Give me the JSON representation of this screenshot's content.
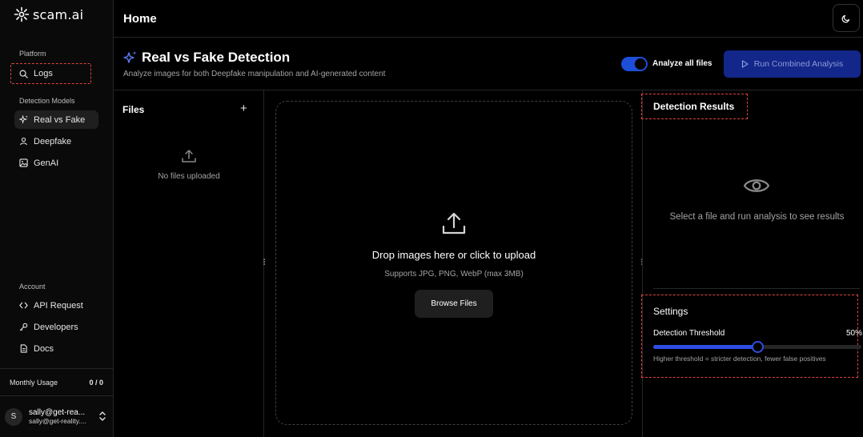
{
  "sidebar": {
    "logo": "scam.ai",
    "platform_label": "Platform",
    "logs_label": "Logs",
    "detection_models_label": "Detection Models",
    "models": [
      {
        "label": "Real vs Fake",
        "icon": "sparkles-icon",
        "active": true
      },
      {
        "label": "Deepfake",
        "icon": "user-icon",
        "active": false
      },
      {
        "label": "GenAI",
        "icon": "image-icon",
        "active": false
      }
    ],
    "account_label": "Account",
    "account_items": [
      {
        "label": "API Request",
        "icon": "code-icon"
      },
      {
        "label": "Developers",
        "icon": "key-icon"
      },
      {
        "label": "Docs",
        "icon": "document-icon"
      }
    ],
    "usage_label": "Monthly Usage",
    "usage_value": "0 / 0",
    "user_initial": "S",
    "user_name": "sally@get-rea...",
    "user_email": "sally@get-reality...."
  },
  "topbar": {
    "title": "Home"
  },
  "header": {
    "title": "Real vs Fake Detection",
    "subtitle": "Analyze images for both Deepfake manipulation and AI-generated content",
    "toggle_label": "Analyze all files",
    "toggle_on": true,
    "run_button": "Run Combined Analysis"
  },
  "files": {
    "title": "Files",
    "add_symbol": "+",
    "empty_text": "No files uploaded"
  },
  "dropzone": {
    "title": "Drop images here or click to upload",
    "subtitle": "Supports JPG, PNG, WebP (max 3MB)",
    "browse_button": "Browse Files"
  },
  "results": {
    "title": "Detection Results",
    "empty_text": "Select a file and run analysis to see results"
  },
  "settings": {
    "title": "Settings",
    "threshold_label": "Detection Threshold",
    "threshold_value": "50%",
    "threshold_fraction": 0.5,
    "threshold_help": "Higher threshold = stricter detection, fewer false positives"
  },
  "colors": {
    "accent": "#2f4de0",
    "run_button_bg": "#13268a",
    "highlight_border": "#e0443e"
  }
}
